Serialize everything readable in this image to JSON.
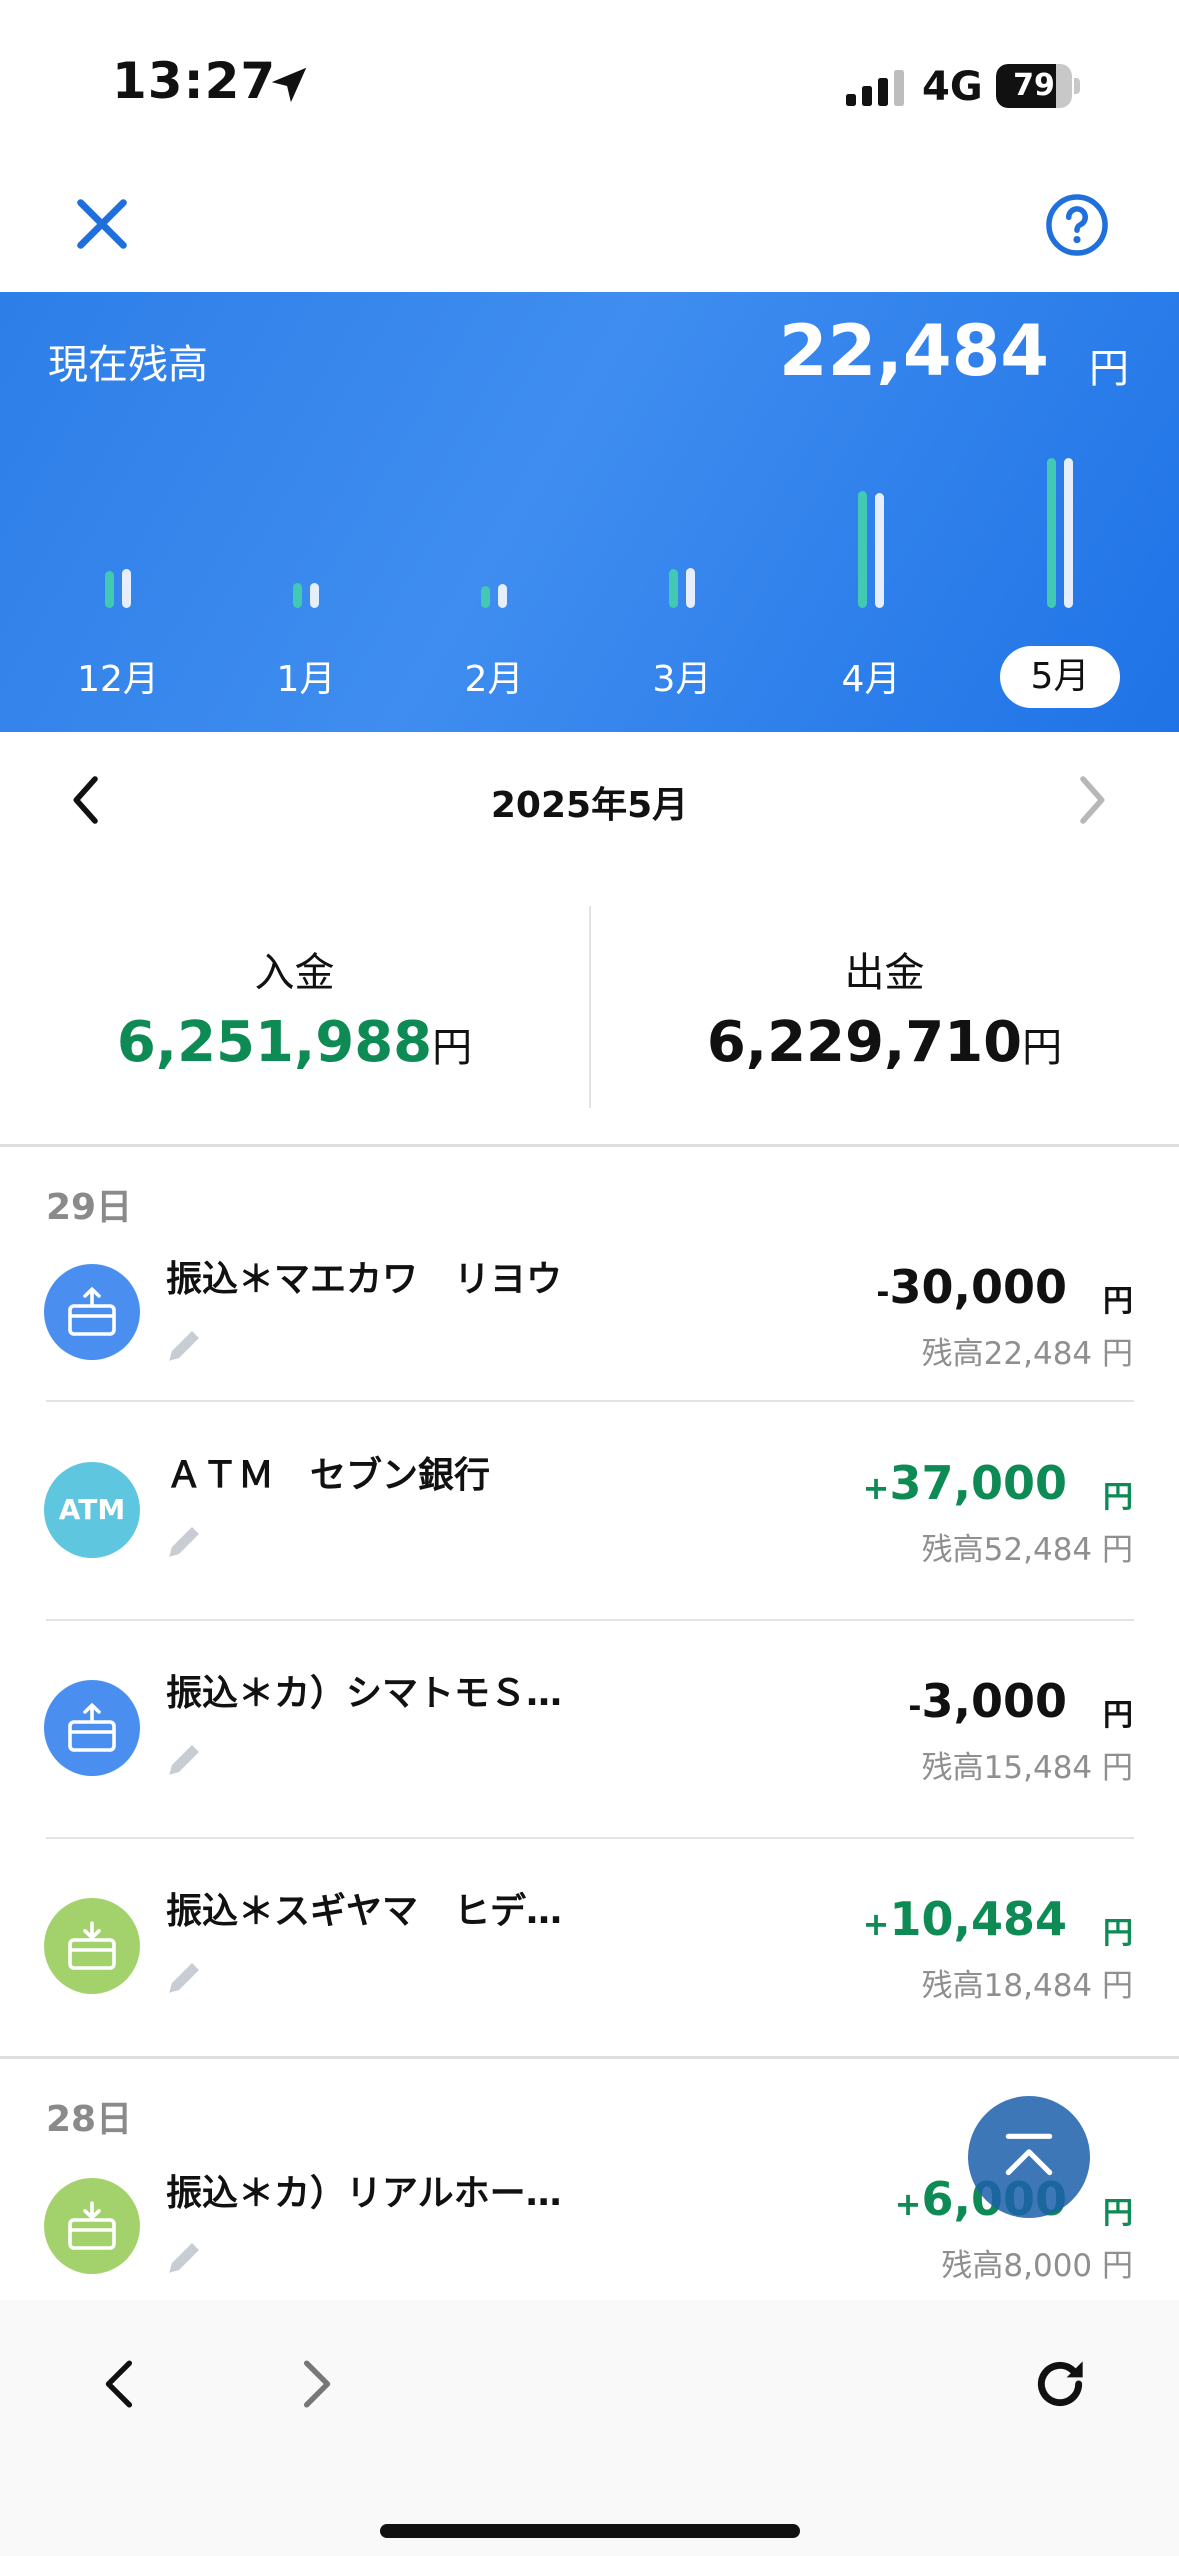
{
  "status_bar": {
    "time": "13:27",
    "network": "4G",
    "battery": 79
  },
  "nav": {
    "close_icon": "close-icon",
    "help_icon": "help-icon"
  },
  "balance": {
    "label": "現在残高",
    "amount": "22,484",
    "unit": "円",
    "months": [
      {
        "label": "12月",
        "income": 0.25,
        "expense": 0.26
      },
      {
        "label": "1月",
        "income": 0.17,
        "expense": 0.17
      },
      {
        "label": "2月",
        "income": 0.15,
        "expense": 0.16
      },
      {
        "label": "3月",
        "income": 0.26,
        "expense": 0.27
      },
      {
        "label": "4月",
        "income": 0.78,
        "expense": 0.77
      },
      {
        "label": "5月",
        "income": 1.0,
        "expense": 1.0
      }
    ],
    "active_month_index": 5
  },
  "month_nav": {
    "title": "2025年5月"
  },
  "summary": {
    "in_label": "入金",
    "in_value": "6,251,988",
    "in_unit": "円",
    "out_label": "出金",
    "out_value": "6,229,710",
    "out_unit": "円"
  },
  "transactions": [
    {
      "day": "29日",
      "items": [
        {
          "icon": "transfer-out-icon",
          "color": "blue",
          "name": "振込＊マエカワ　リヨウ",
          "sign": "-",
          "amount": "30,000",
          "unit": "円",
          "balance": "残高22,484 円",
          "type": "minus"
        },
        {
          "icon": "atm-icon",
          "atm_text": "ATM",
          "color": "teal",
          "name": "ＡＴＭ　セブン銀行",
          "sign": "+",
          "amount": "37,000",
          "unit": "円",
          "balance": "残高52,484 円",
          "type": "plus"
        },
        {
          "icon": "transfer-out-icon",
          "color": "blue",
          "name": "振込＊カ）シマトモＳ…",
          "sign": "-",
          "amount": "3,000",
          "unit": "円",
          "balance": "残高15,484 円",
          "type": "minus"
        },
        {
          "icon": "transfer-in-icon",
          "color": "green",
          "name": "振込＊スギヤマ　ヒデ…",
          "sign": "+",
          "amount": "10,484",
          "unit": "円",
          "balance": "残高18,484 円",
          "type": "plus"
        }
      ]
    },
    {
      "day": "28日",
      "items": [
        {
          "icon": "transfer-in-icon",
          "color": "green",
          "name": "振込＊カ）リアルホー…",
          "sign": "+",
          "amount": "6,000",
          "unit": "円",
          "balance": "残高8,000 円",
          "type": "plus"
        }
      ]
    }
  ],
  "colors": {
    "accent": "#1f73e6",
    "plus": "#0e8a55",
    "income_bar": "#42c9b3"
  }
}
